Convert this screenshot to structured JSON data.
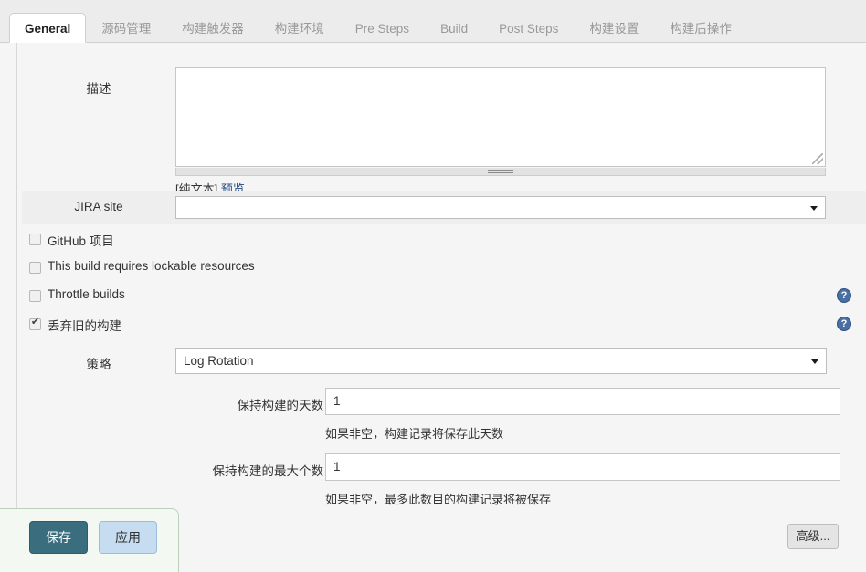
{
  "tabs": [
    {
      "label": "General",
      "active": true
    },
    {
      "label": "源码管理",
      "active": false
    },
    {
      "label": "构建触发器",
      "active": false
    },
    {
      "label": "构建环境",
      "active": false
    },
    {
      "label": "Pre Steps",
      "active": false
    },
    {
      "label": "Build",
      "active": false
    },
    {
      "label": "Post Steps",
      "active": false
    },
    {
      "label": "构建设置",
      "active": false
    },
    {
      "label": "构建后操作",
      "active": false
    }
  ],
  "description": {
    "label": "描述",
    "value": "",
    "placeholder": "",
    "plain_text_label": "[纯文本]",
    "preview_link": "预览"
  },
  "jira": {
    "label": "JIRA site",
    "selected": "",
    "options": [
      ""
    ]
  },
  "checkboxes": [
    {
      "label": "GitHub 项目",
      "checked": false,
      "help": false
    },
    {
      "label": "This build requires lockable resources",
      "checked": false,
      "help": false
    },
    {
      "label": "Throttle builds",
      "checked": false,
      "help": true
    },
    {
      "label": "丢弃旧的构建",
      "checked": true,
      "help": true
    }
  ],
  "strategy": {
    "label": "策略",
    "selected": "Log Rotation",
    "options": [
      "Log Rotation"
    ]
  },
  "log_rotation": {
    "days_label": "保持构建的天数",
    "days_value": "1",
    "days_hint": "如果非空，构建记录将保存此天数",
    "max_label": "保持构建的最大个数",
    "max_value": "1",
    "max_hint": "如果非空，最多此数目的构建记录将被保存"
  },
  "footer": {
    "save_label": "保存",
    "apply_label": "应用",
    "advanced_label": "高级...",
    "help_icon_glyph": "?"
  },
  "colors": {
    "save_button": "#3a6e7e",
    "apply_button": "#c6dcf0",
    "help_icon": "#4a6fa5",
    "link": "#204a87"
  }
}
